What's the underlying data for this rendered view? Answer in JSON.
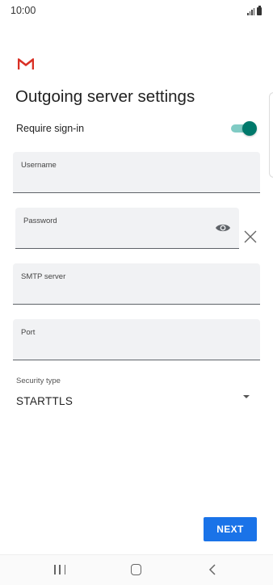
{
  "status_bar": {
    "time": "10:00"
  },
  "app": {
    "logo_icon": "gmail-m-icon",
    "brand_color": "#d93025"
  },
  "page": {
    "title": "Outgoing server settings"
  },
  "require_sign_in": {
    "label": "Require sign-in",
    "checked": true,
    "accent": "#00796b"
  },
  "fields": {
    "username": {
      "label": "Username",
      "value": ""
    },
    "password": {
      "label": "Password",
      "value": "",
      "visibility_icon": "eye-icon",
      "clear_icon": "close-icon"
    },
    "smtp_server": {
      "label": "SMTP server",
      "value": ""
    },
    "port": {
      "label": "Port",
      "value": ""
    }
  },
  "security_type": {
    "label": "Security type",
    "value": "STARTTLS"
  },
  "actions": {
    "next_label": "NEXT",
    "next_color": "#1a73e8"
  },
  "nav_bar": {
    "recents_icon": "recents-icon",
    "home_icon": "home-icon",
    "back_icon": "back-icon"
  }
}
